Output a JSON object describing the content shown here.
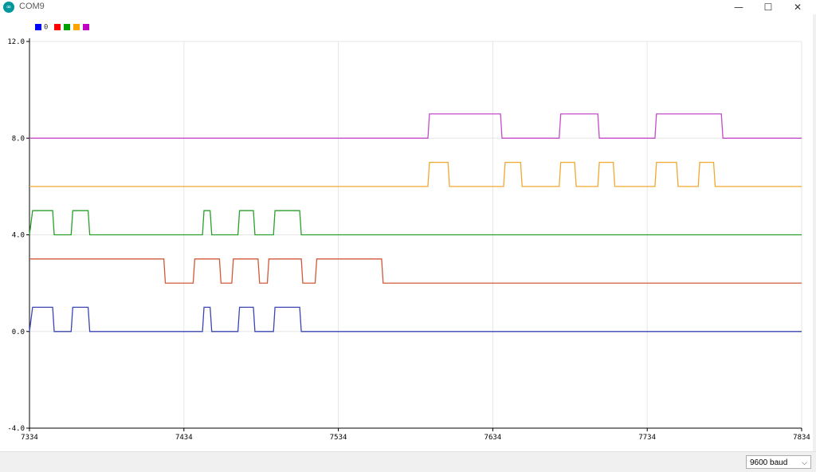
{
  "window": {
    "title": "COM9",
    "icon": "arduino-icon",
    "controls": {
      "minimize": "—",
      "maximize": "☐",
      "close": "✕"
    }
  },
  "legend": {
    "label": "0",
    "colors": [
      "#0000ff",
      "#ff0000",
      "#00a000",
      "#ffa500",
      "#c000c0"
    ]
  },
  "status": {
    "baud": "9600 baud",
    "baud_icon": "chevron-down-icon"
  },
  "chart_data": {
    "type": "line",
    "title": "",
    "xlabel": "",
    "ylabel": "",
    "xlim": [
      7334,
      7834
    ],
    "ylim": [
      -4.0,
      12.0
    ],
    "x_ticks": [
      7334,
      7434,
      7534,
      7634,
      7734,
      7834
    ],
    "y_ticks": [
      -4.0,
      0.0,
      4.0,
      8.0,
      12.0
    ],
    "x_tick_labels": [
      "7334",
      "7434",
      "7534",
      "7634",
      "7734",
      "7834"
    ],
    "y_tick_labels": [
      "-4.0",
      "0.0",
      "4.0",
      "8.0",
      "12.0"
    ],
    "grid": true,
    "series": [
      {
        "color": "#3a46b4",
        "points": [
          [
            7334,
            0
          ],
          [
            7336,
            1
          ],
          [
            7349,
            1
          ],
          [
            7350,
            0
          ],
          [
            7361,
            0
          ],
          [
            7362,
            1
          ],
          [
            7372,
            1
          ],
          [
            7373,
            0
          ],
          [
            7446,
            0
          ],
          [
            7447,
            1
          ],
          [
            7451,
            1
          ],
          [
            7452,
            0
          ],
          [
            7469,
            0
          ],
          [
            7470,
            1
          ],
          [
            7479,
            1
          ],
          [
            7480,
            0
          ],
          [
            7492,
            0
          ],
          [
            7493,
            1
          ],
          [
            7509,
            1
          ],
          [
            7510,
            0
          ],
          [
            7834,
            0
          ]
        ]
      },
      {
        "color": "#d2583a",
        "points": [
          [
            7334,
            3
          ],
          [
            7421,
            3
          ],
          [
            7422,
            2
          ],
          [
            7440,
            2
          ],
          [
            7441,
            3
          ],
          [
            7457,
            3
          ],
          [
            7458,
            2
          ],
          [
            7465,
            2
          ],
          [
            7466,
            3
          ],
          [
            7482,
            3
          ],
          [
            7483,
            2
          ],
          [
            7488,
            2
          ],
          [
            7489,
            3
          ],
          [
            7510,
            3
          ],
          [
            7511,
            2
          ],
          [
            7519,
            2
          ],
          [
            7520,
            3
          ],
          [
            7562,
            3
          ],
          [
            7563,
            2
          ],
          [
            7834,
            2
          ]
        ]
      },
      {
        "color": "#2aa02a",
        "points": [
          [
            7334,
            4
          ],
          [
            7336,
            5
          ],
          [
            7349,
            5
          ],
          [
            7350,
            4
          ],
          [
            7361,
            4
          ],
          [
            7362,
            5
          ],
          [
            7372,
            5
          ],
          [
            7373,
            4
          ],
          [
            7446,
            4
          ],
          [
            7447,
            5
          ],
          [
            7451,
            5
          ],
          [
            7452,
            4
          ],
          [
            7469,
            4
          ],
          [
            7470,
            5
          ],
          [
            7479,
            5
          ],
          [
            7480,
            4
          ],
          [
            7492,
            4
          ],
          [
            7493,
            5
          ],
          [
            7509,
            5
          ],
          [
            7510,
            4
          ],
          [
            7834,
            4
          ]
        ]
      },
      {
        "color": "#f0a830",
        "points": [
          [
            7334,
            6
          ],
          [
            7592,
            6
          ],
          [
            7593,
            7
          ],
          [
            7605,
            7
          ],
          [
            7606,
            6
          ],
          [
            7641,
            6
          ],
          [
            7642,
            7
          ],
          [
            7652,
            7
          ],
          [
            7653,
            6
          ],
          [
            7677,
            6
          ],
          [
            7678,
            7
          ],
          [
            7687,
            7
          ],
          [
            7688,
            6
          ],
          [
            7702,
            6
          ],
          [
            7703,
            7
          ],
          [
            7712,
            7
          ],
          [
            7713,
            6
          ],
          [
            7739,
            6
          ],
          [
            7740,
            7
          ],
          [
            7753,
            7
          ],
          [
            7754,
            6
          ],
          [
            7767,
            6
          ],
          [
            7768,
            7
          ],
          [
            7777,
            7
          ],
          [
            7778,
            6
          ],
          [
            7834,
            6
          ]
        ]
      },
      {
        "color": "#c34cc8",
        "points": [
          [
            7334,
            8
          ],
          [
            7592,
            8
          ],
          [
            7593,
            9
          ],
          [
            7639,
            9
          ],
          [
            7640,
            8
          ],
          [
            7677,
            8
          ],
          [
            7678,
            9
          ],
          [
            7702,
            9
          ],
          [
            7703,
            8
          ],
          [
            7739,
            8
          ],
          [
            7740,
            9
          ],
          [
            7782,
            9
          ],
          [
            7783,
            8
          ],
          [
            7834,
            8
          ]
        ]
      }
    ]
  }
}
